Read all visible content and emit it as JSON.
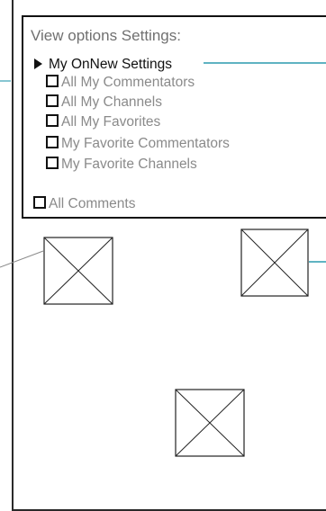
{
  "panel": {
    "title": "View options Settings:",
    "selected_option": "My OnNew Settings",
    "options": [
      "All My Commentators",
      "All My Channels",
      "All My Favorites",
      "My Favorite Commentators",
      "My Favorite Channels"
    ],
    "extra_option": "All Comments"
  },
  "placeholders": [
    "image-placeholder",
    "image-placeholder",
    "image-placeholder"
  ],
  "colors": {
    "annotation_line": "#5fb3c2",
    "border": "#111111",
    "muted_text": "#8a8a8a"
  }
}
